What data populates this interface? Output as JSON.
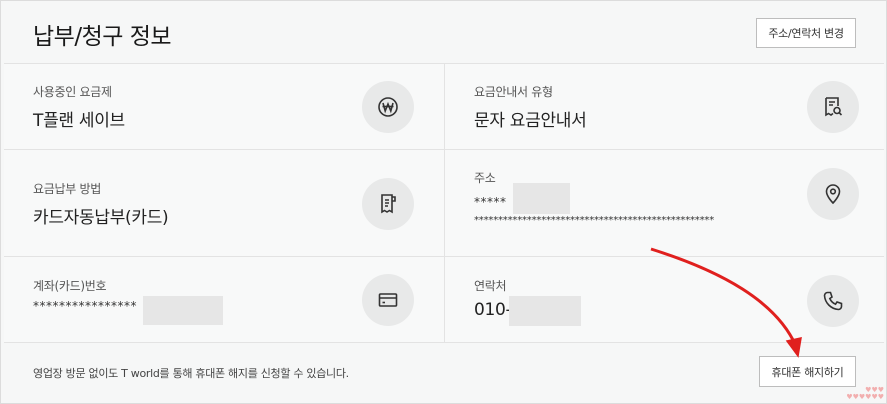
{
  "header": {
    "title": "납부/청구 정보",
    "change_button": "주소/연락처 변경"
  },
  "items": {
    "plan": {
      "label": "사용중인 요금제",
      "value": "T플랜 세이브",
      "icon": "won-icon"
    },
    "bill_type": {
      "label": "요금안내서 유형",
      "value": "문자 요금안내서",
      "icon": "bill-search-icon"
    },
    "payment_method": {
      "label": "요금납부 방법",
      "value": "카드자동납부(카드)",
      "icon": "receipt-icon"
    },
    "address": {
      "label": "주소",
      "line1": "*****",
      "line2": "**************************************************",
      "icon": "location-pin-icon"
    },
    "account": {
      "label": "계좌(카드)번호",
      "value": "****************",
      "icon": "card-icon"
    },
    "contact": {
      "label": "연락처",
      "value": "010-",
      "icon": "phone-icon"
    }
  },
  "footer": {
    "text": "영업장 방문 없이도 T world를 통해 휴대폰 해지를 신청할 수 있습니다.",
    "cancel_button": "휴대폰 해지하기"
  },
  "colors": {
    "arrow": "#e0201e",
    "icon_bg": "#e8e9e9",
    "panel_bg": "#f6f7f7"
  }
}
